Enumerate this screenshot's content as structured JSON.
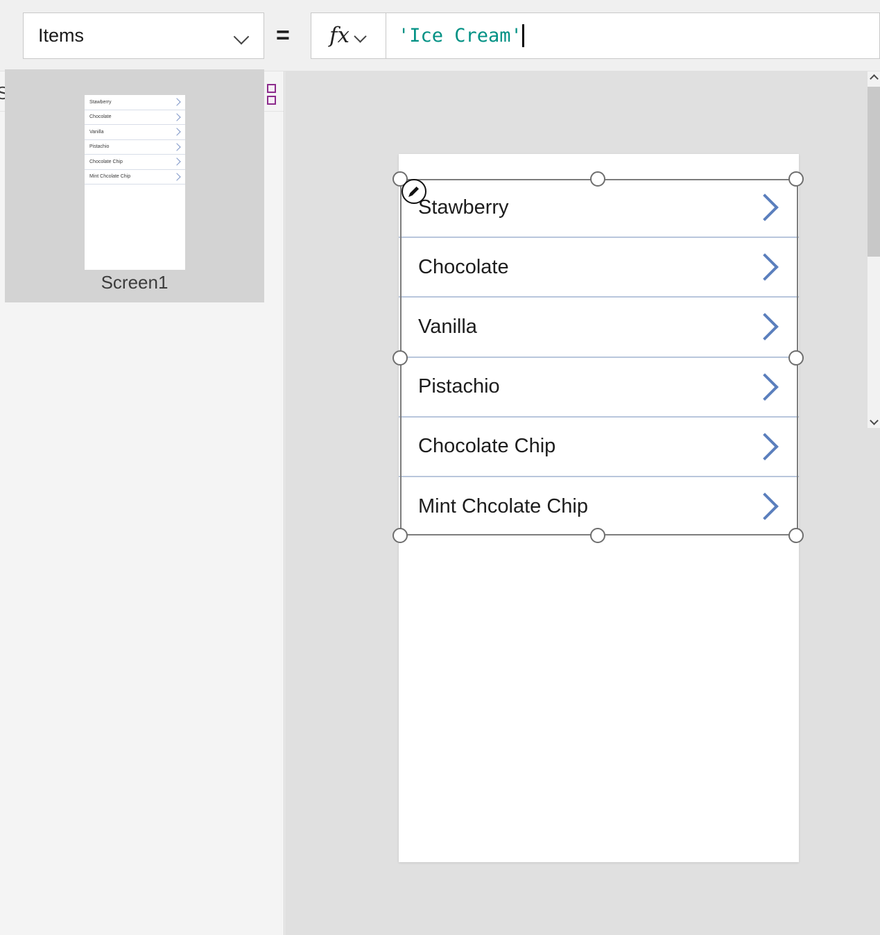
{
  "formula_bar": {
    "property_label": "Items",
    "equals": "=",
    "fx_glyph": "fx",
    "formula_value": "'Ice Cream'"
  },
  "left_panel": {
    "title": "Screens",
    "view_toggle": {
      "tree_view_name": "tree-view-icon",
      "grid_view_name": "grid-view-icon"
    },
    "screens": [
      {
        "name": "Screen1",
        "items": [
          "Stawberry",
          "Chocolate",
          "Vanilla",
          "Pistachio",
          "Chocolate Chip",
          "Mint Chcolate Chip"
        ]
      }
    ]
  },
  "canvas": {
    "gallery": {
      "items": [
        "Stawberry",
        "Chocolate",
        "Vanilla",
        "Pistachio",
        "Chocolate Chip",
        "Mint Chcolate Chip"
      ],
      "chevron_color": "#5b7fbd",
      "separator_color": "#b8c6dc"
    },
    "selection": {
      "handle_count": 8,
      "edit_badge_name": "pencil-edit-badge"
    }
  },
  "colors": {
    "accent_purple": "#8c2b8c",
    "formula_text": "#009184",
    "canvas_bg": "#e0e0e0",
    "panel_bg": "#f4f4f4"
  }
}
